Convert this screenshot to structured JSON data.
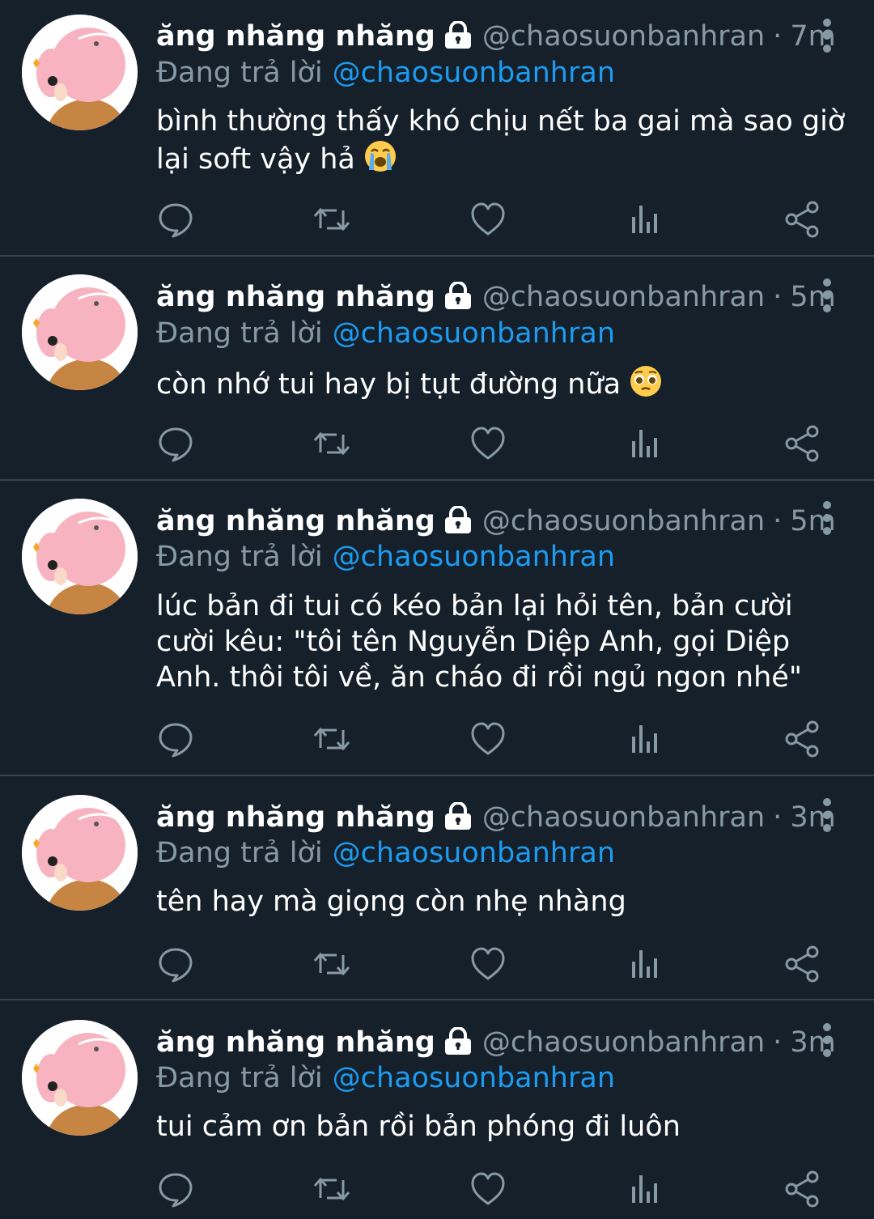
{
  "colors": {
    "background": "#15202b",
    "divider": "#38444d",
    "text_primary": "#ffffff",
    "text_secondary": "#8899a6",
    "link": "#1d9bf0"
  },
  "tweets": [
    {
      "display_name": "ăng nhăng nhăng",
      "handle": "@chaosuonbanhran",
      "separator": "·",
      "time": "7m",
      "reply_prefix": "Đang trả lời",
      "reply_to": "@chaosuonbanhran",
      "text": "bình thường thấy khó chịu nết ba gai mà sao giờ lại soft vậy hả",
      "emoji": "loudly-crying-face-icon"
    },
    {
      "display_name": "ăng nhăng nhăng",
      "handle": "@chaosuonbanhran",
      "separator": "·",
      "time": "5m",
      "reply_prefix": "Đang trả lời",
      "reply_to": "@chaosuonbanhran",
      "text": "còn nhớ tui hay bị tụt đường nữa",
      "emoji": "pleading-face-icon"
    },
    {
      "display_name": "ăng nhăng nhăng",
      "handle": "@chaosuonbanhran",
      "separator": "·",
      "time": "5m",
      "reply_prefix": "Đang trả lời",
      "reply_to": "@chaosuonbanhran",
      "text": "lúc bản đi tui có kéo bản lại hỏi tên, bản cười cười kêu: \"tôi tên Nguyễn Diệp Anh, gọi Diệp Anh. thôi tôi về, ăn cháo đi rồi ngủ ngon nhé\""
    },
    {
      "display_name": "ăng nhăng nhăng",
      "handle": "@chaosuonbanhran",
      "separator": "·",
      "time": "3m",
      "reply_prefix": "Đang trả lời",
      "reply_to": "@chaosuonbanhran",
      "text": "tên hay mà giọng còn nhẹ nhàng"
    },
    {
      "display_name": "ăng nhăng nhăng",
      "handle": "@chaosuonbanhran",
      "separator": "·",
      "time": "3m",
      "reply_prefix": "Đang trả lời",
      "reply_to": "@chaosuonbanhran",
      "text": "tui cảm ơn bản rồi bản phóng đi luôn"
    }
  ]
}
